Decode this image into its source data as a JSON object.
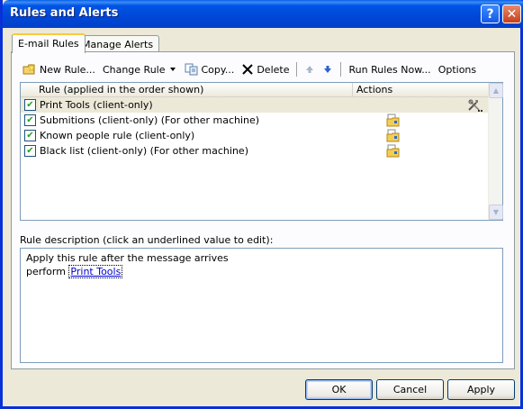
{
  "window": {
    "title": "Rules and Alerts"
  },
  "titlebar": {
    "help_glyph": "?",
    "close_glyph": "✕"
  },
  "tabs": [
    {
      "label": "E-mail Rules",
      "active": true
    },
    {
      "label": "Manage Alerts",
      "active": false
    }
  ],
  "toolbar": {
    "new_rule": "New Rule...",
    "change_rule": "Change Rule",
    "copy": "Copy...",
    "delete": "Delete",
    "run_rules_now": "Run Rules Now...",
    "options": "Options"
  },
  "rules_table": {
    "columns": [
      "Rule (applied in the order shown)",
      "Actions"
    ],
    "rows": [
      {
        "label": "Print Tools  (client-only)",
        "checked": true,
        "selected": true,
        "action_icon": "tools-icon"
      },
      {
        "label": "Submitions  (client-only)  (For other machine)",
        "checked": true,
        "selected": false,
        "action_icon": "move-to-folder-icon"
      },
      {
        "label": "Known people rule  (client-only)",
        "checked": true,
        "selected": false,
        "action_icon": "move-to-folder-icon"
      },
      {
        "label": "Black list  (client-only)  (For other machine)",
        "checked": true,
        "selected": false,
        "action_icon": "move-to-folder-icon"
      }
    ]
  },
  "description": {
    "label": "Rule description (click an underlined value to edit):",
    "line1": "Apply this rule after the message arrives",
    "line2_prefix": "perform ",
    "line2_link": "Print Tools"
  },
  "buttons": {
    "ok": "OK",
    "cancel": "Cancel",
    "apply": "Apply"
  },
  "colors": {
    "title_bar": "#0055e5",
    "dialog_bg": "#ece9d8",
    "link": "#0000cc",
    "selected_row": "#ece9d8"
  }
}
